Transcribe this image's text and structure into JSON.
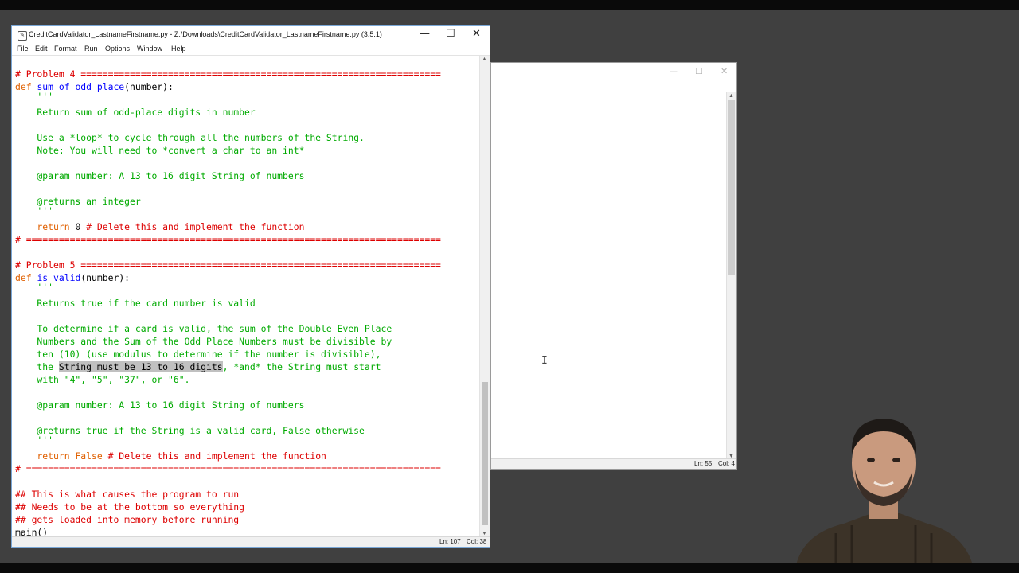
{
  "editor_window": {
    "title": "CreditCardValidator_LastnameFirstname.py - Z:\\Downloads\\CreditCardValidator_LastnameFirstname.py (3.5.1)",
    "icon": "python-file-icon",
    "controls": {
      "minimize": "—",
      "maximize": "☐",
      "close": "✕"
    },
    "menu": [
      "File",
      "Edit",
      "Format",
      "Run",
      "Options",
      "Window",
      "Help"
    ],
    "status": {
      "line": "Ln: 107",
      "col": "Col: 38"
    }
  },
  "code": {
    "p4_header": "# Problem 4 ==================================================================",
    "p4_def_kw": "def ",
    "p4_def_name": "sum_of_odd_place",
    "p4_def_args": "(number):",
    "p4_doc_open": "    '''",
    "p4_doc1": "    Return sum of odd-place digits in number",
    "p4_doc2": "    Use a *loop* to cycle through all the numbers of the String.",
    "p4_doc3": "    Note: You will need to *convert a char to an int*",
    "p4_doc4": "    @param number: A 13 to 16 digit String of numbers",
    "p4_doc5": "    @returns an integer",
    "p4_doc_close": "    '''",
    "p4_return_kw": "    return ",
    "p4_return_val": "0 ",
    "p4_return_comment": "# Delete this and implement the function",
    "p4_footer": "# ============================================================================",
    "p5_header": "# Problem 5 ==================================================================",
    "p5_def_kw": "def ",
    "p5_def_name": "is_valid",
    "p5_def_args": "(number):",
    "p5_doc_open": "    '''",
    "p5_doc1": "    Returns true if the card number is valid",
    "p5_doc2": "    To determine if a card is valid, the sum of the Double Even Place",
    "p5_doc3": "    Numbers and the Sum of the Odd Place Numbers must be divisible by",
    "p5_doc4": "    ten (10) (use modulus to determine if the number is divisible),",
    "p5_doc5_pre": "    the ",
    "p5_doc5_sel": "String must be 13 to 16 digits",
    "p5_doc5_post": ", *and* the String must start",
    "p5_doc6": "    with \"4\", \"5\", \"37\", or \"6\".",
    "p5_doc7": "    @param number: A 13 to 16 digit String of numbers",
    "p5_doc8": "    @returns true if the String is a valid card, False otherwise",
    "p5_doc_close": "    '''",
    "p5_return_kw": "    return ",
    "p5_return_val": "False ",
    "p5_return_comment": "# Delete this and implement the function",
    "p5_footer": "# ============================================================================",
    "main_c1": "## This is what causes the program to run",
    "main_c2": "## Needs to be at the bottom so everything",
    "main_c3": "## gets loaded into memory before running",
    "main_call": "main()"
  },
  "shell_window": {
    "controls": {
      "minimize": "—",
      "maximize": "☐",
      "close": "✕"
    },
    "status": {
      "line": "Ln: 55",
      "col": "Col: 4"
    }
  },
  "colors": {
    "comment": "#dd0000",
    "keyword": "#e06000",
    "defname": "#0000ff",
    "string": "#00aa00",
    "selection": "#c0c0c0"
  }
}
